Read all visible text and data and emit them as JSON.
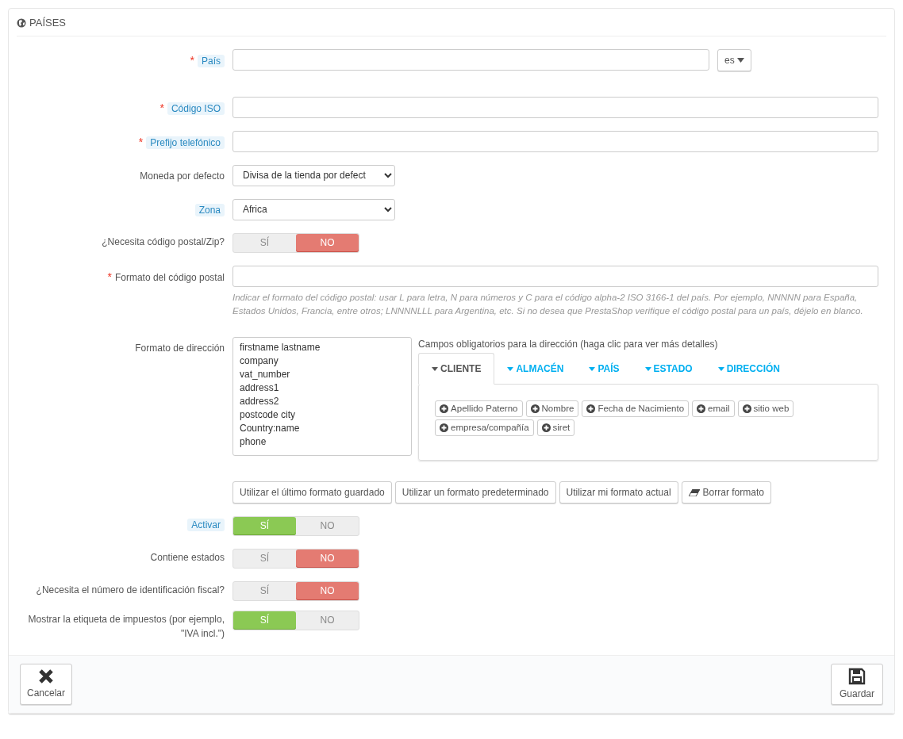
{
  "panel": {
    "title": "PAÍSES"
  },
  "fields": [
    {
      "kind": "text_lang",
      "label": "País",
      "required_mark": "*",
      "hinted": true,
      "lang": "es"
    },
    {
      "kind": "text",
      "label": "Código ISO",
      "required_mark": "*",
      "hinted": true
    },
    {
      "kind": "text",
      "label": "Prefijo telefónico",
      "required_mark": "*",
      "hinted": true
    },
    {
      "kind": "select",
      "label": "Moneda por defecto",
      "hinted": false,
      "value": "Divisa de la tienda por defect"
    },
    {
      "kind": "select",
      "label": "Zona",
      "hinted": true,
      "value": "Africa"
    },
    {
      "kind": "switch",
      "label": "¿Necesita código postal/Zip?",
      "hinted": false,
      "yes": "SÍ",
      "no": "NO",
      "on": false
    },
    {
      "kind": "text",
      "label": "Formato del código postal",
      "required_mark": "*",
      "hinted": false,
      "help": "Indicar el formato del código postal: usar L para letra, N para números y C para el código alpha-2 ISO 3166-1 del país. Por ejemplo, NNNNN para España, Estados Unidos, Francia, entre otros; LNNNNLLL para Argentina, etc. Si no desea que PrestaShop verifique el código postal para un país, déjelo en blanco."
    },
    {
      "kind": "address",
      "label": "Formato de dirección",
      "hinted": false,
      "lines": [
        "firstname lastname",
        "company",
        "vat_number",
        "address1",
        "address2",
        "postcode city",
        "Country:name",
        "phone"
      ],
      "fields_title": "Campos obligatorios para la dirección (haga clic para ver más detalles)",
      "tabs": [
        {
          "label": "CLIENTE",
          "selected": true
        },
        {
          "label": "ALMACÉN",
          "selected": false
        },
        {
          "label": "PAÍS",
          "selected": false
        },
        {
          "label": "ESTADO",
          "selected": false
        },
        {
          "label": "DIRECCIÓN",
          "selected": false
        }
      ],
      "chips": [
        "Apellido Paterno",
        "Nombre",
        "Fecha de Nacimiento",
        "email",
        "sitio web",
        "empresa/compañía",
        "siret"
      ]
    },
    {
      "kind": "buttons",
      "buttons": [
        {
          "label": "Utilizar el último formato guardado",
          "kind": "plain"
        },
        {
          "label": "Utilizar un formato predeterminado",
          "kind": "plain"
        },
        {
          "label": "Utilizar mi formato actual",
          "kind": "plain"
        },
        {
          "label": "Borrar formato",
          "kind": "clear"
        }
      ]
    },
    {
      "kind": "switch",
      "label": "Activar",
      "hinted": true,
      "yes": "SÍ",
      "no": "NO",
      "on": true
    },
    {
      "kind": "switch",
      "label": "Contiene estados",
      "hinted": false,
      "yes": "SÍ",
      "no": "NO",
      "on": false
    },
    {
      "kind": "switch",
      "label": "¿Necesita el número de identificación fiscal?",
      "hinted": false,
      "yes": "SÍ",
      "no": "NO",
      "on": false
    },
    {
      "kind": "switch",
      "label": "Mostrar la etiqueta de impuestos (por ejemplo, \"IVA incl.\")",
      "hinted": false,
      "yes": "SÍ",
      "no": "NO",
      "on": true
    }
  ],
  "footer": [
    {
      "label": "Cancelar",
      "kind": "cancel"
    },
    {
      "label": "Guardar",
      "kind": "save"
    }
  ]
}
